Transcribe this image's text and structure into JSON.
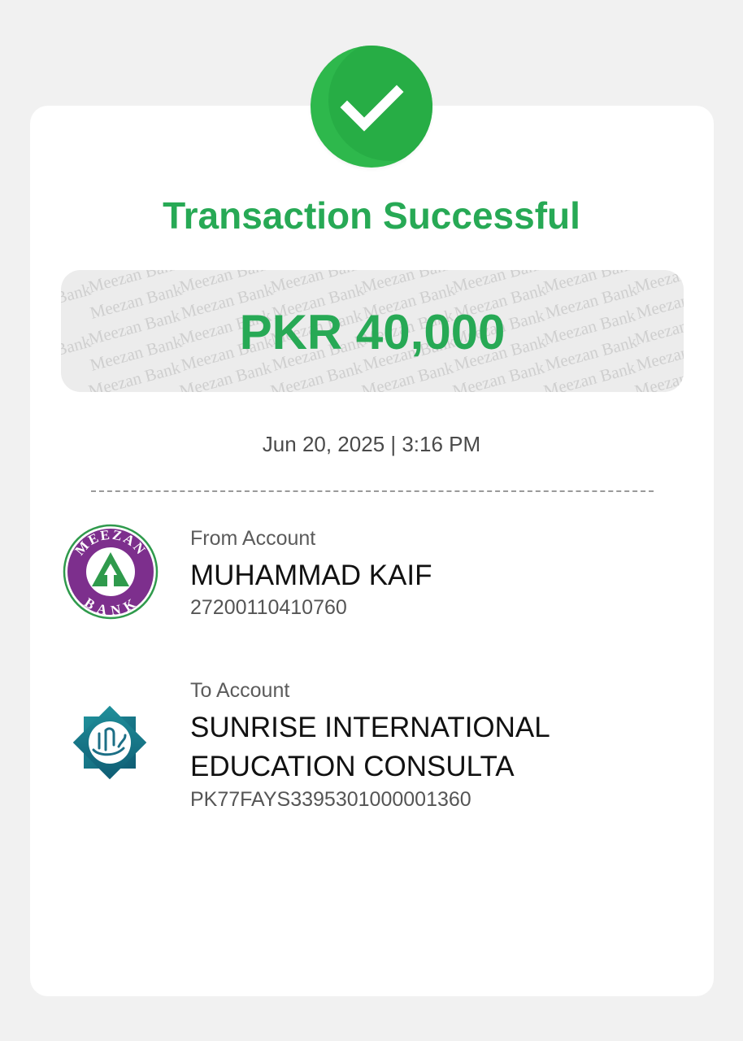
{
  "status": {
    "title": "Transaction Successful",
    "icon": "checkmark-icon",
    "color": "#27a955"
  },
  "amount": {
    "text": "PKR 40,000",
    "watermark": "Meezan Bank"
  },
  "datetime": "Jun 20, 2025 | 3:16 PM",
  "from_account": {
    "label": "From Account",
    "name": "MUHAMMAD KAIF",
    "number": "27200110410760",
    "bank_logo": "meezan-bank-logo",
    "logo_text_top": "MEEZAN",
    "logo_text_bottom": "BANK"
  },
  "to_account": {
    "label": "To Account",
    "name_line1": "SUNRISE INTERNATIONAL",
    "name_line2": "EDUCATION CONSULTA",
    "number": "PK77FAYS3395301000001360",
    "bank_logo": "faysal-bank-islami-logo"
  }
}
